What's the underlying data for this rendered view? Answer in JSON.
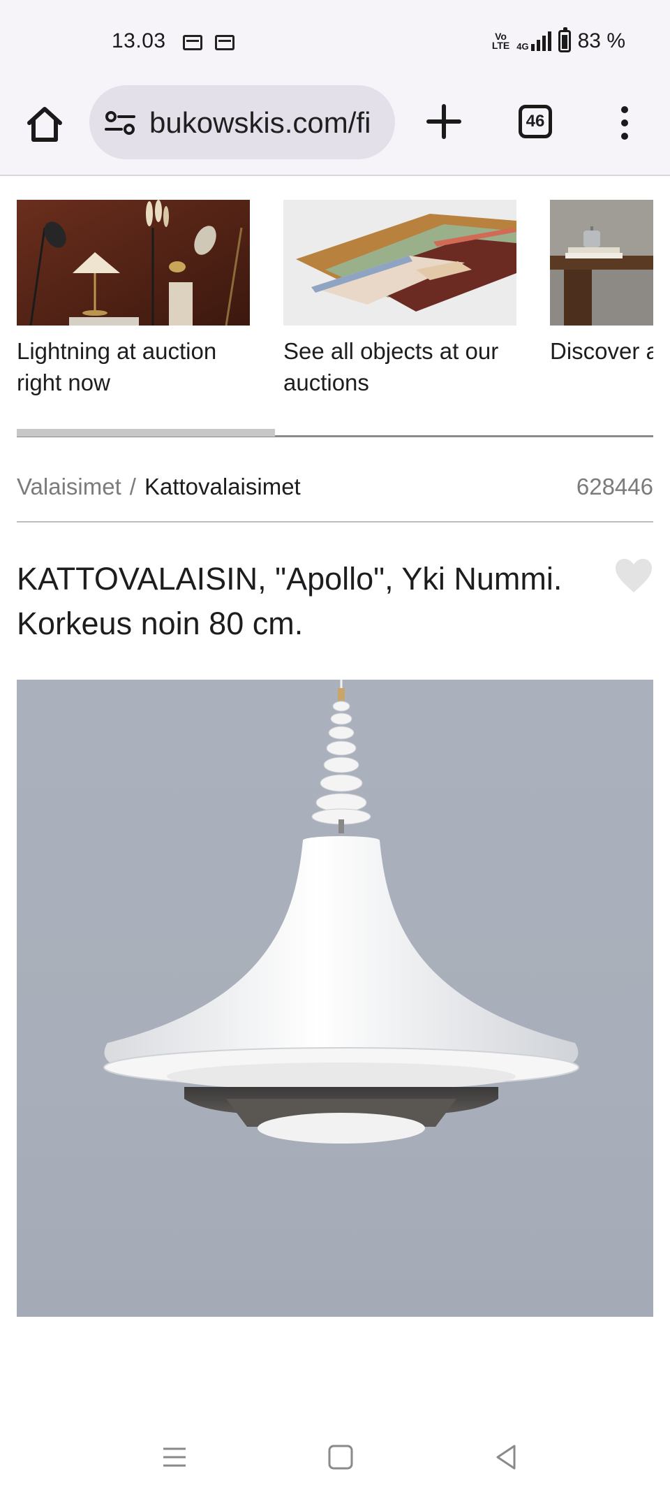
{
  "status_bar": {
    "time": "13.03",
    "network_top": "Vo",
    "network_bottom": "LTE",
    "network_type": "4G",
    "battery": "83 %"
  },
  "browser": {
    "url": "bukowskis.com/fi",
    "tab_count": "46",
    "icons": [
      "home-icon",
      "site-info-icon",
      "new-tab-icon",
      "tabs-icon",
      "more-vert-icon"
    ]
  },
  "carousel": {
    "cards": [
      {
        "label": "Lightning at auction right now",
        "image": "lamps-photo"
      },
      {
        "label": "See all objects at our auctions",
        "image": "rugs-photo"
      },
      {
        "label": "Discover auctions",
        "image": "table-photo"
      }
    ]
  },
  "breadcrumb": {
    "parent": "Valaisimet",
    "separator": "/",
    "current": "Kattovalaisimet"
  },
  "lot": {
    "number": "628446",
    "title": "KATTOVALAISIN, \"Apollo\", Yki Nummi. Korkeus noin 80 cm.",
    "image": "pendant-lamp-photo"
  },
  "navbar": {
    "icons": [
      "recent-apps-icon",
      "home-nav-icon",
      "back-icon"
    ]
  },
  "colors": {
    "browser_chrome": "#f6f3f9",
    "url_pill": "#e3e0ea",
    "hero_background": "#aab1bc",
    "muted_text": "#7b7b7b"
  }
}
